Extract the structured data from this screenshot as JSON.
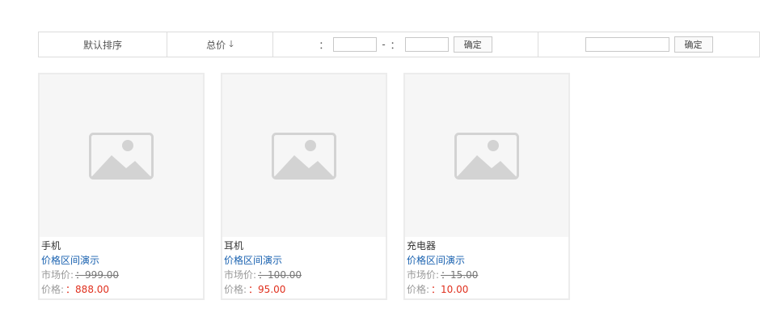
{
  "toolbar": {
    "sort_default": "默认排序",
    "sort_total": "总价",
    "sort_total_arrow": "🡓",
    "range_colon_1": "：",
    "range_sep": "-",
    "range_colon_2": "：",
    "range_from_value": "",
    "range_to_value": "",
    "range_confirm": "确定",
    "keyword_value": "",
    "keyword_confirm": "确定"
  },
  "products": [
    {
      "name": "手机",
      "link": "价格区间演示",
      "market_label": "市场价:",
      "market_price": "：999.00",
      "price_label": "价格:",
      "price": "：888.00"
    },
    {
      "name": "耳机",
      "link": "价格区间演示",
      "market_label": "市场价:",
      "market_price": "：100.00",
      "price_label": "价格:",
      "price": "：95.00"
    },
    {
      "name": "充电器",
      "link": "价格区间演示",
      "market_label": "市场价:",
      "market_price": "：15.00",
      "price_label": "价格:",
      "price": "：10.00"
    }
  ],
  "colors": {
    "link": "#1a62b0",
    "price": "#e0301e",
    "placeholder_bg": "#f6f6f6",
    "placeholder_icon": "#d3d3d3"
  },
  "icons": {
    "placeholder": "image-placeholder-icon",
    "sort_arrow": "arrow-down-icon"
  }
}
